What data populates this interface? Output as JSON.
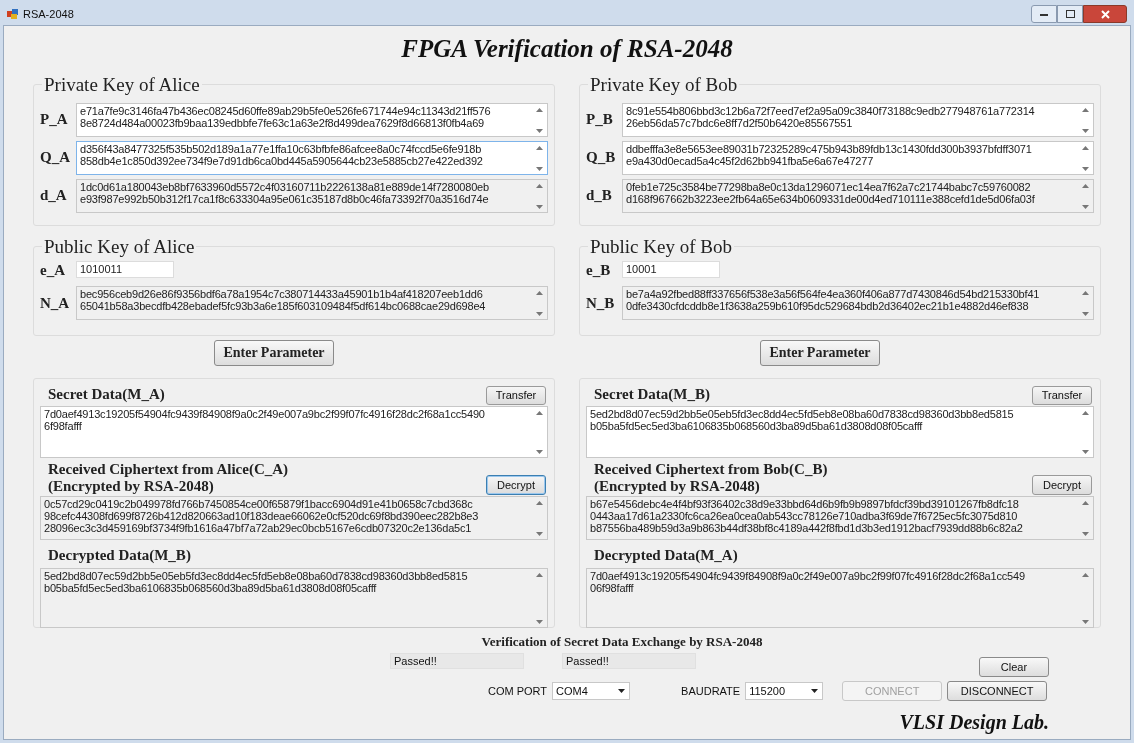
{
  "window": {
    "title": "RSA-2048"
  },
  "heading": "FPGA Verification of RSA-2048",
  "parties": [
    {
      "private_key": {
        "title": "Private Key of Alice",
        "fields": [
          {
            "label": "P_A",
            "lines": [
              "e71a7fe9c3146fa47b436ec08245d60ffe89ab29b5fe0e526fe671744e94c11343d21ff576",
              "8e8724d484a00023fb9baa139edbbfe7fe63c1a63e2f8d499dea7629f8d66813f0fb4a69"
            ],
            "readonly": false,
            "focused": false
          },
          {
            "label": "Q_A",
            "lines": [
              "d356f43a8477325f535b502d189a1a77e1ffa10c63bfbfe86afcee8a0c74fccd5e6fe918b",
              "858db4e1c850d392ee734f9e7d91db6ca0bd445a5905644cb23e5885cb27e422ed392"
            ],
            "readonly": false,
            "focused": true
          },
          {
            "label": "d_A",
            "lines": [
              "1dc0d61a180043eb8bf7633960d5572c4f03160711b2226138a81e889de14f7280080eb",
              "e93f987e992b50b312f17ca1f8c633304a95e061c35187d8b0c46fa73392f70a3516d74e"
            ],
            "readonly": true,
            "focused": false
          }
        ]
      },
      "public_key": {
        "title": "Public Key of Alice",
        "exponent": {
          "label": "e_A",
          "value": "1010011"
        },
        "modulus": {
          "label": "N_A",
          "lines": [
            "bec956ceb9d26e86f9356bdf6a78a1954c7c380714433a45901b1b4af418207eeb1dd6",
            "65041b58a3becdfb428ebadef5fc93b3a6e185f603109484f5df614bc0688cae29d698e4"
          ],
          "readonly": true
        }
      },
      "enter_button": "Enter Parameter",
      "secret": {
        "label": "Secret Data(M_A)",
        "button": "Transfer",
        "lines": [
          "7d0aef4913c19205f54904fc9439f84908f9a0c2f49e007a9bc2f99f07fc4916f28dc2f68a1cc5490",
          "6f98fafff"
        ],
        "readonly": false
      },
      "cipher": {
        "label_lines": [
          "Received Ciphertext from Alice(C_A)",
          "(Encrypted by RSA-2048)"
        ],
        "button": "Decrypt",
        "button_focused": true,
        "lines": [
          "0c57cd29c0419c2b049978fd766b7450854ce00f65879f1bacc6904d91e41b0658c7cbd368c",
          "98cefc44308fd699f8726b412d820663ad10f183deae66062e0cf520dc69f8bd390eec282b8e3",
          "28096ec3c3d459169bf3734f9fb1616a47bf7a72ab29ec0bcb5167e6cdb07320c2e136da5c1"
        ],
        "readonly": true
      },
      "decrypted": {
        "label": "Decrypted Data(M_B)",
        "lines": [
          "5ed2bd8d07ec59d2bb5e05eb5fd3ec8dd4ec5fd5eb8e08ba60d7838cd98360d3bb8ed5815",
          "b05ba5fd5ec5ed3ba6106835b068560d3ba89d5ba61d3808d08f05cafff"
        ],
        "readonly": true
      }
    },
    {
      "private_key": {
        "title": "Private Key of Bob",
        "fields": [
          {
            "label": "P_B",
            "lines": [
              "8c91e554b806bbd3c12b6a72f7eed7ef2a95a09c3840f73188c9edb277948761a772314",
              "26eb56da57c7bdc6e8ff7d2f50b6420e85567551"
            ],
            "readonly": false,
            "focused": false
          },
          {
            "label": "Q_B",
            "lines": [
              "ddbefffa3e8e5653ee89031b72325289c475b943b89fdb13c1430fdd300b3937bfdff3071",
              "e9a430d0ecad5a4c45f2d62bb941fba5e6a67e47277"
            ],
            "readonly": false,
            "focused": false
          },
          {
            "label": "d_B",
            "lines": [
              "0feb1e725c3584be77298ba8e0c13da1296071ec14ea7f62a7c21744babc7c59760082",
              "d168f967662b3223ee2fb64a65e634b0609331de00d4ed710111e388cefd1de5d06fa03f"
            ],
            "readonly": true,
            "focused": false
          }
        ]
      },
      "public_key": {
        "title": "Public Key of Bob",
        "exponent": {
          "label": "e_B",
          "value": "10001"
        },
        "modulus": {
          "label": "N_B",
          "lines": [
            "be7a4a92fbed88ff337656f538e3a56f564fe4ea360f406a877d7430846d54bd215330bf41",
            "0dfe3430cfdcddb8e1f3638a259b610f95dc529684bdb2d36402ec21b1e4882d46ef838"
          ],
          "readonly": true
        }
      },
      "enter_button": "Enter Parameter",
      "secret": {
        "label": "Secret Data(M_B)",
        "button": "Transfer",
        "lines": [
          "5ed2bd8d07ec59d2bb5e05eb5fd3ec8dd4ec5fd5eb8e08ba60d7838cd98360d3bb8ed5815",
          "b05ba5fd5ec5ed3ba6106835b068560d3ba89d5ba61d3808d08f05cafff"
        ],
        "readonly": false
      },
      "cipher": {
        "label_lines": [
          "Received Ciphertext from Bob(C_B)",
          "(Encrypted by RSA-2048)"
        ],
        "button": "Decrypt",
        "button_focused": false,
        "lines": [
          "b67e5456debc4e4f4bf93f36402c38d9e33bbd64d6b9fb9b9897bfdcf39bd39101267fb8dfc18",
          "0443aa17d61a2330fc6ca26ea0cea0ab543cc78126e710adba3f69de7f6725ec5fc3075d810",
          "b87556ba489b59d3a9b863b44df38bf8c4189a442f8fbd1d3b3ed1912bacf7939dd88b6c82a2"
        ],
        "readonly": true
      },
      "decrypted": {
        "label": "Decrypted Data(M_A)",
        "lines": [
          "7d0aef4913c19205f54904fc9439f84908f9a0c2f49e007a9bc2f99f07fc4916f28dc2f68a1cc549",
          "06f98fafff"
        ],
        "readonly": true
      }
    }
  ],
  "verification": {
    "title": "Verification of Secret Data Exchange by RSA-2048",
    "results": [
      "Passed!!",
      "Passed!!"
    ]
  },
  "clear_button": "Clear",
  "com_port": {
    "label": "COM PORT",
    "value": "COM4"
  },
  "baudrate": {
    "label": "BAUDRATE",
    "value": "115200"
  },
  "connect": {
    "label": "CONNECT",
    "disabled": true
  },
  "disconnect": {
    "label": "DISCONNECT",
    "disabled": false
  },
  "footer": "VLSI Design Lab."
}
